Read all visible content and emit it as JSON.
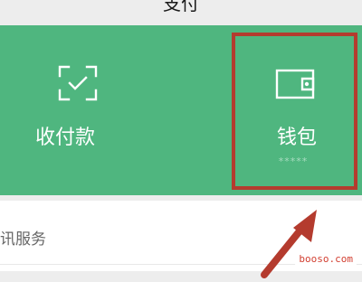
{
  "header": {
    "title": "支付"
  },
  "tiles": [
    {
      "label": "收付款",
      "icon": "scan-icon"
    },
    {
      "label": "钱包",
      "sub": "*****",
      "icon": "wallet-icon"
    }
  ],
  "section": {
    "title": "腾讯服务"
  },
  "annotation": {
    "highlight_color": "#b43b2e",
    "target": "钱包"
  },
  "watermark": "booso.com",
  "colors": {
    "panel": "#4fb67f",
    "background": "#ededed"
  }
}
